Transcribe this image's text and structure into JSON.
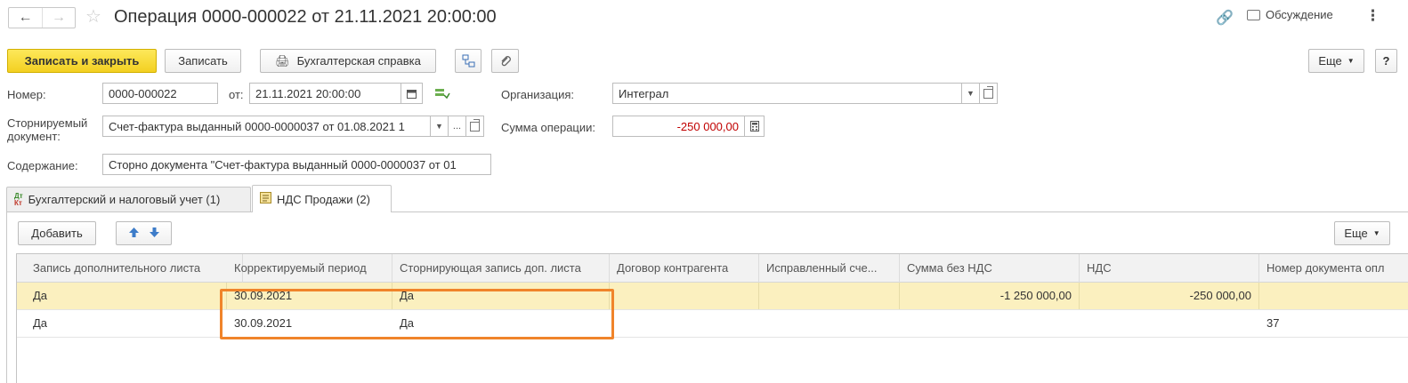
{
  "header": {
    "title": "Операция 0000-000022 от 21.11.2021 20:00:00",
    "discussion_label": "Обсуждение"
  },
  "toolbar": {
    "save_close": "Записать и закрыть",
    "save": "Записать",
    "accounting_note": "Бухгалтерская справка",
    "more": "Еще",
    "help": "?"
  },
  "form": {
    "number_label": "Номер:",
    "number_value": "0000-000022",
    "date_label": "от:",
    "date_value": "21.11.2021 20:00:00",
    "org_label": "Организация:",
    "org_value": "Интеграл",
    "storno_label_line1": "Сторнируемый",
    "storno_label_line2": "документ:",
    "storno_value": "Счет-фактура выданный 0000-0000037 от 01.08.2021 1",
    "sum_label": "Сумма операции:",
    "sum_value": "-250 000,00",
    "content_label": "Содержание:",
    "content_value": "Сторно документа \"Счет-фактура выданный 0000-0000037 от 01"
  },
  "tabs": [
    {
      "label": "Бухгалтерский и налоговый учет (1)",
      "icon": "dt-kt-icon"
    },
    {
      "label": "НДС Продажи (2)",
      "icon": "register-icon"
    }
  ],
  "table_toolbar": {
    "add": "Добавить",
    "more": "Еще"
  },
  "table": {
    "columns": [
      "Запись дополнительного листа",
      "Корректируемый период",
      "Сторнирующая запись доп. листа",
      "Договор контрагента",
      "Исправленный сче...",
      "Сумма без НДС",
      "НДС",
      "Номер документа опл"
    ],
    "rows": [
      {
        "cells": [
          "Да",
          "30.09.2021",
          "Да",
          "",
          "",
          "-1 250 000,00",
          "-250 000,00",
          ""
        ]
      },
      {
        "cells": [
          "Да",
          "30.09.2021",
          "Да",
          "",
          "",
          "",
          "",
          "37"
        ]
      }
    ]
  },
  "colors": {
    "primary_button": "#f3d021",
    "selected_row": "#fbf0bf",
    "highlight_frame": "#f0842a",
    "negative_amount": "#c00000"
  }
}
